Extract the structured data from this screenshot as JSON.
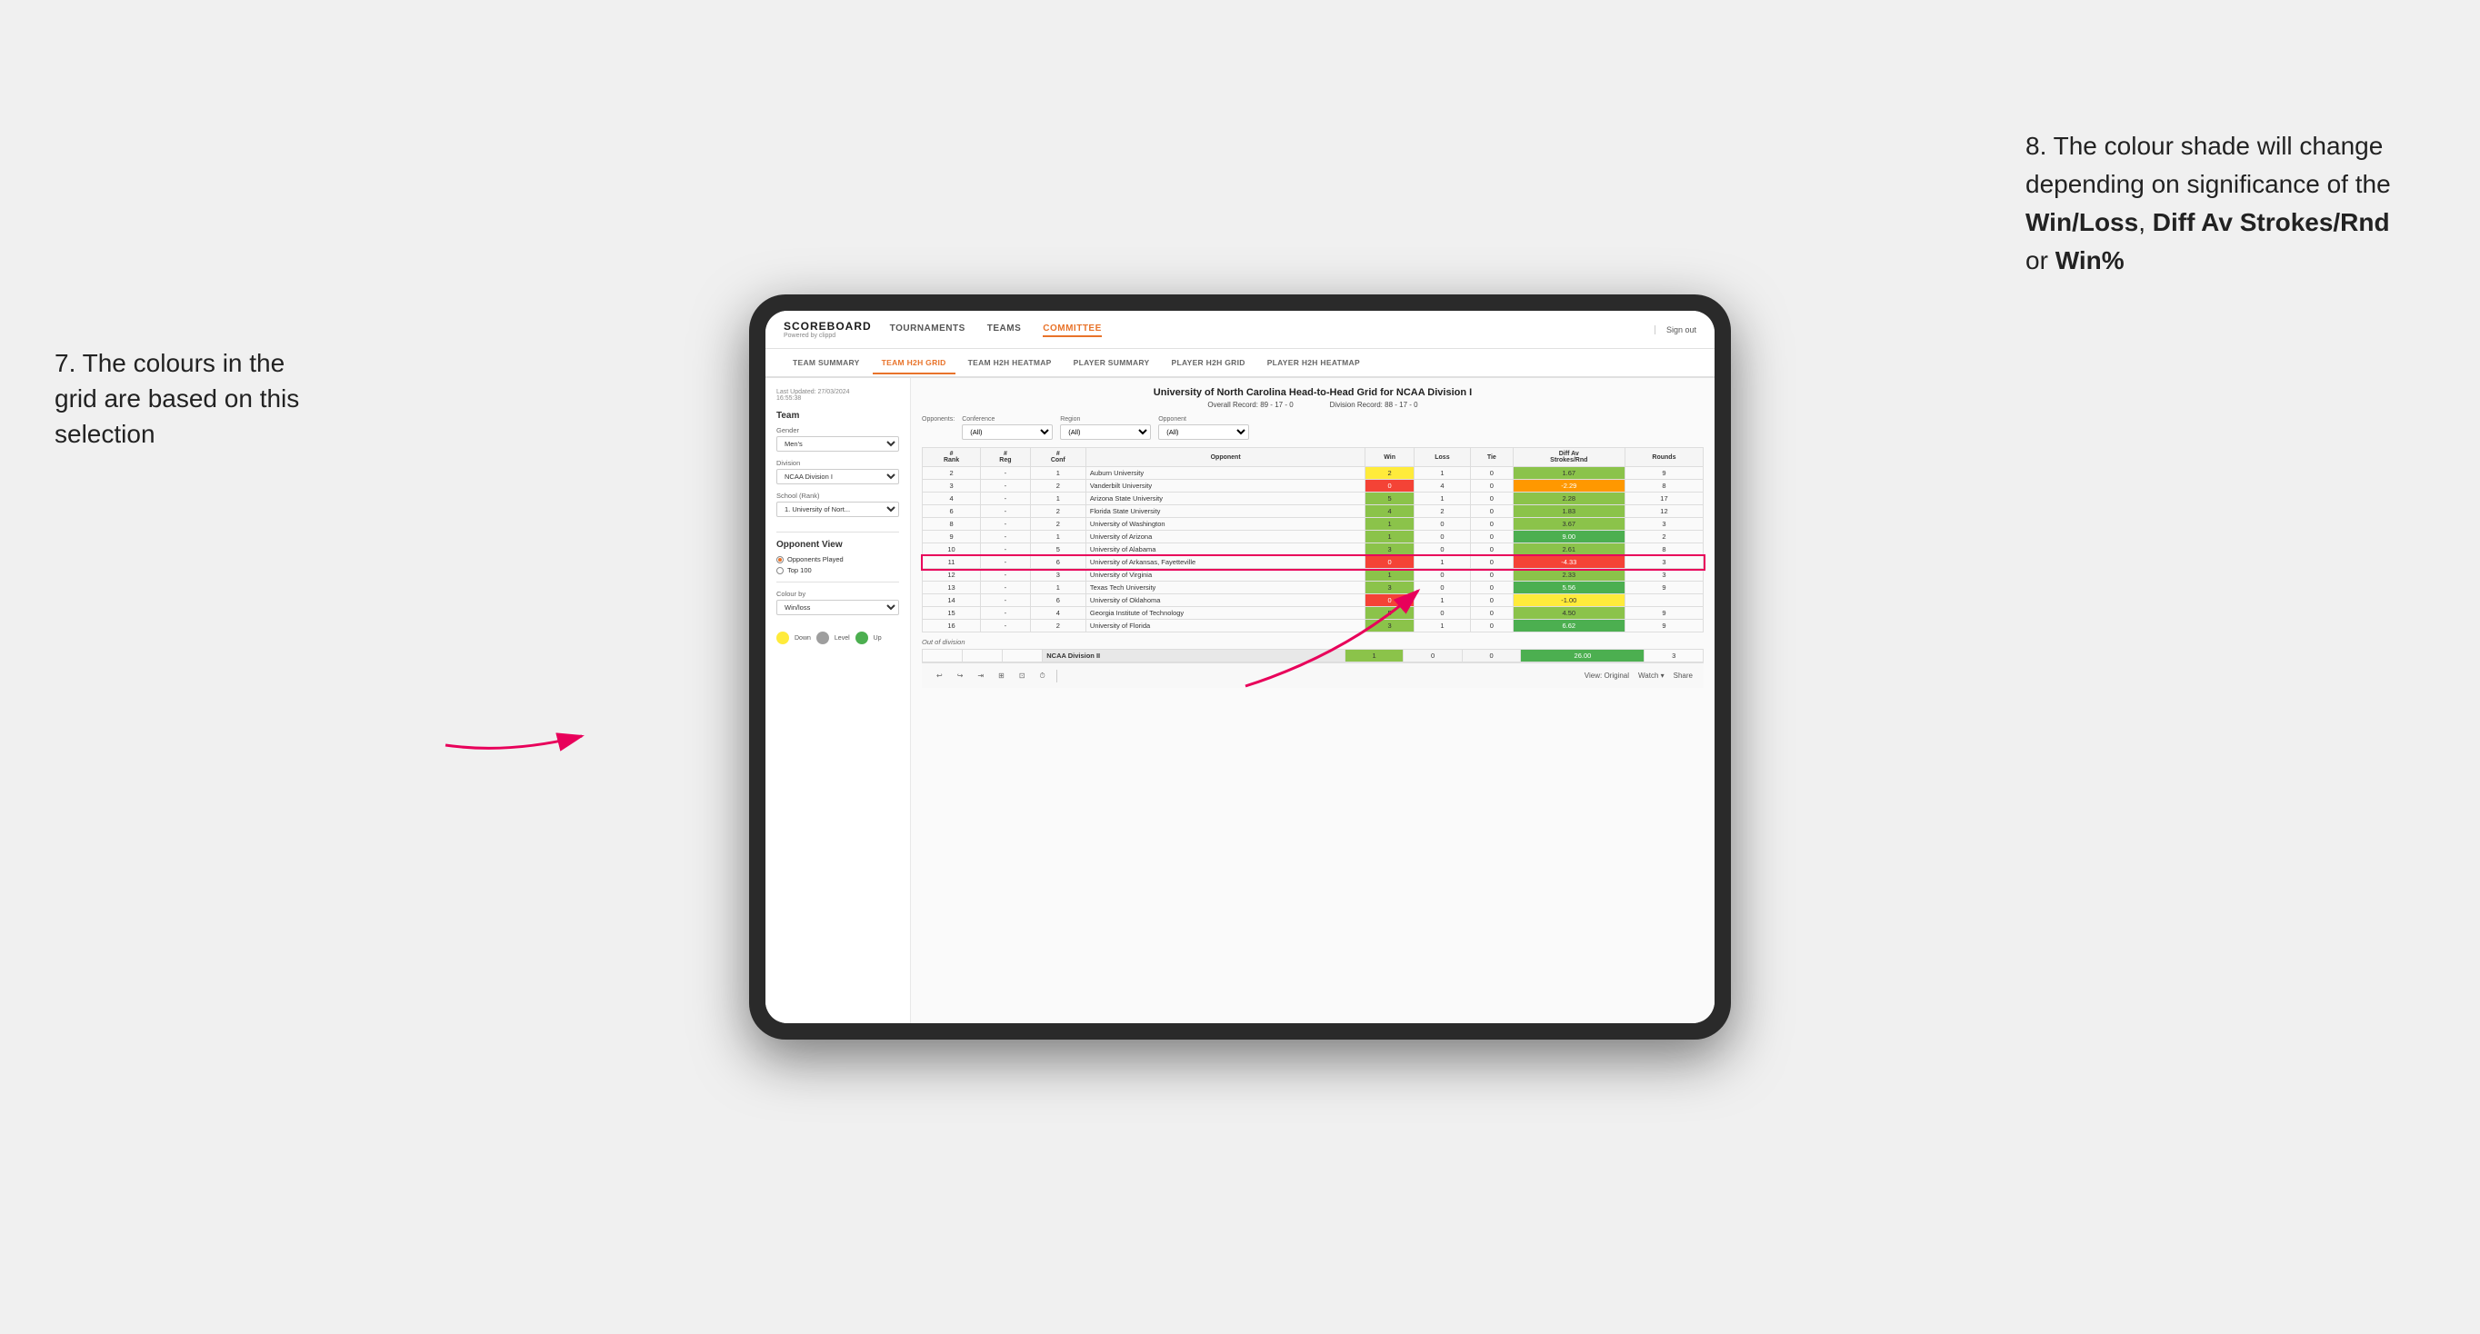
{
  "annotations": {
    "left": {
      "text": "7. The colours in the grid are based on this selection"
    },
    "right": {
      "intro": "8. The colour shade will change depending on significance of the ",
      "bold1": "Win/Loss",
      "sep1": ", ",
      "bold2": "Diff Av Strokes/Rnd",
      "sep2": " or ",
      "bold3": "Win%"
    }
  },
  "nav": {
    "logo": "SCOREBOARD",
    "powered": "Powered by clippd",
    "items": [
      "TOURNAMENTS",
      "TEAMS",
      "COMMITTEE"
    ],
    "active_item": "COMMITTEE",
    "sign_out": "Sign out"
  },
  "sub_nav": {
    "items": [
      "TEAM SUMMARY",
      "TEAM H2H GRID",
      "TEAM H2H HEATMAP",
      "PLAYER SUMMARY",
      "PLAYER H2H GRID",
      "PLAYER H2H HEATMAP"
    ],
    "active_item": "TEAM H2H GRID"
  },
  "left_panel": {
    "timestamp_label": "Last Updated: 27/03/2024",
    "timestamp_time": "16:55:38",
    "team_section": "Team",
    "gender_label": "Gender",
    "gender_value": "Men's",
    "division_label": "Division",
    "division_value": "NCAA Division I",
    "school_label": "School (Rank)",
    "school_value": "1. University of Nort...",
    "opponent_view_label": "Opponent View",
    "radio_options": [
      "Opponents Played",
      "Top 100"
    ],
    "radio_selected": "Opponents Played",
    "colour_by_label": "Colour by",
    "colour_by_value": "Win/loss",
    "legend": {
      "down_label": "Down",
      "level_label": "Level",
      "up_label": "Up"
    }
  },
  "grid": {
    "title": "University of North Carolina Head-to-Head Grid for NCAA Division I",
    "overall_record_label": "Overall Record:",
    "overall_record_value": "89 - 17 - 0",
    "division_record_label": "Division Record:",
    "division_record_value": "88 - 17 - 0",
    "filters": {
      "conference_label": "Conference",
      "conference_value": "(All)",
      "region_label": "Region",
      "region_value": "(All)",
      "opponent_label": "Opponent",
      "opponent_value": "(All)",
      "opponents_label": "Opponents:"
    },
    "columns": [
      "#\nRank",
      "#\nReg",
      "#\nConf",
      "Opponent",
      "Win",
      "Loss",
      "Tie",
      "Diff Av\nStrokes/Rnd",
      "Rounds"
    ],
    "rows": [
      {
        "rank": "2",
        "reg": "-",
        "conf": "1",
        "opponent": "Auburn University",
        "win": "2",
        "loss": "1",
        "tie": "0",
        "diff": "1.67",
        "rounds": "9",
        "win_color": "yellow",
        "diff_color": "green"
      },
      {
        "rank": "3",
        "reg": "-",
        "conf": "2",
        "opponent": "Vanderbilt University",
        "win": "0",
        "loss": "4",
        "tie": "0",
        "diff": "-2.29",
        "rounds": "8",
        "win_color": "red",
        "diff_color": "orange"
      },
      {
        "rank": "4",
        "reg": "-",
        "conf": "1",
        "opponent": "Arizona State University",
        "win": "5",
        "loss": "1",
        "tie": "0",
        "diff": "2.28",
        "rounds": "17",
        "win_color": "green",
        "diff_color": "green"
      },
      {
        "rank": "6",
        "reg": "-",
        "conf": "2",
        "opponent": "Florida State University",
        "win": "4",
        "loss": "2",
        "tie": "0",
        "diff": "1.83",
        "rounds": "12",
        "win_color": "green",
        "diff_color": "green"
      },
      {
        "rank": "8",
        "reg": "-",
        "conf": "2",
        "opponent": "University of Washington",
        "win": "1",
        "loss": "0",
        "tie": "0",
        "diff": "3.67",
        "rounds": "3",
        "win_color": "green",
        "diff_color": "green"
      },
      {
        "rank": "9",
        "reg": "-",
        "conf": "1",
        "opponent": "University of Arizona",
        "win": "1",
        "loss": "0",
        "tie": "0",
        "diff": "9.00",
        "rounds": "2",
        "win_color": "green",
        "diff_color": "green-dark"
      },
      {
        "rank": "10",
        "reg": "-",
        "conf": "5",
        "opponent": "University of Alabama",
        "win": "3",
        "loss": "0",
        "tie": "0",
        "diff": "2.61",
        "rounds": "8",
        "win_color": "green",
        "diff_color": "green"
      },
      {
        "rank": "11",
        "reg": "-",
        "conf": "6",
        "opponent": "University of Arkansas, Fayetteville",
        "win": "0",
        "loss": "1",
        "tie": "0",
        "diff": "-4.33",
        "rounds": "3",
        "win_color": "red",
        "diff_color": "red",
        "highlighted": true
      },
      {
        "rank": "12",
        "reg": "-",
        "conf": "3",
        "opponent": "University of Virginia",
        "win": "1",
        "loss": "0",
        "tie": "0",
        "diff": "2.33",
        "rounds": "3",
        "win_color": "green",
        "diff_color": "green"
      },
      {
        "rank": "13",
        "reg": "-",
        "conf": "1",
        "opponent": "Texas Tech University",
        "win": "3",
        "loss": "0",
        "tie": "0",
        "diff": "5.56",
        "rounds": "9",
        "win_color": "green",
        "diff_color": "green-dark"
      },
      {
        "rank": "14",
        "reg": "-",
        "conf": "6",
        "opponent": "University of Oklahoma",
        "win": "0",
        "loss": "1",
        "tie": "0",
        "diff": "-1.00",
        "rounds": "",
        "win_color": "red",
        "diff_color": "yellow"
      },
      {
        "rank": "15",
        "reg": "-",
        "conf": "4",
        "opponent": "Georgia Institute of Technology",
        "win": "5",
        "loss": "0",
        "tie": "0",
        "diff": "4.50",
        "rounds": "9",
        "win_color": "green",
        "diff_color": "green"
      },
      {
        "rank": "16",
        "reg": "-",
        "conf": "2",
        "opponent": "University of Florida",
        "win": "3",
        "loss": "1",
        "tie": "0",
        "diff": "6.62",
        "rounds": "9",
        "win_color": "green",
        "diff_color": "green-dark"
      }
    ],
    "out_of_division_label": "Out of division",
    "out_of_division_row": {
      "label": "NCAA Division II",
      "win": "1",
      "loss": "0",
      "tie": "0",
      "diff": "26.00",
      "rounds": "3",
      "diff_color": "green-dark"
    }
  },
  "toolbar": {
    "view_label": "View: Original",
    "watch_label": "Watch ▾",
    "share_label": "Share"
  }
}
